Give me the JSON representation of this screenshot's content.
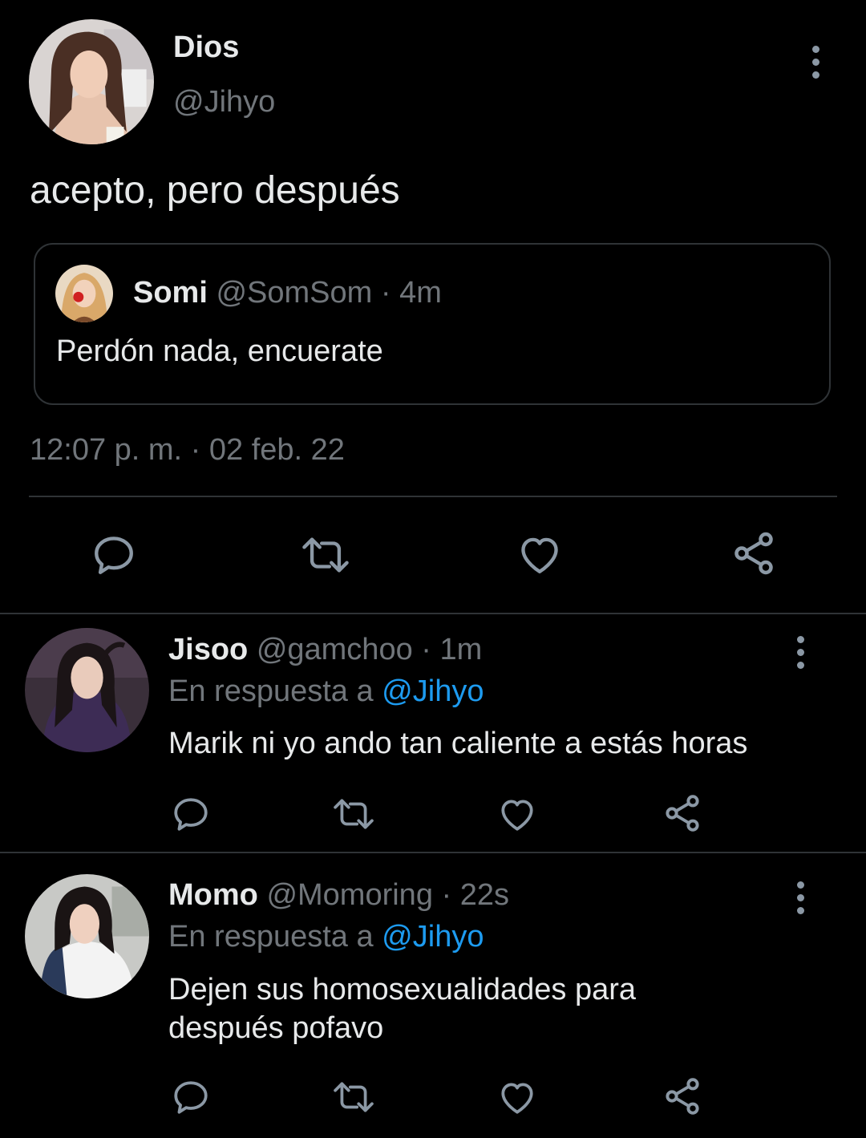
{
  "main_tweet": {
    "display_name": "Dios",
    "handle": "@Jihyo",
    "text": "acepto, pero después",
    "timestamp": "12:07 p. m. · 02 feb. 22",
    "quoted": {
      "display_name": "Somi",
      "handle": "@SomSom",
      "separator": "·",
      "time": "4m",
      "text": "Perdón nada, encuerate"
    }
  },
  "replies": [
    {
      "display_name": "Jisoo",
      "handle": "@gamchoo",
      "separator": "·",
      "time": "1m",
      "in_reply_prefix": "En respuesta a",
      "in_reply_mention": "@Jihyo",
      "text": "Marik ni yo ando tan caliente a estás horas"
    },
    {
      "display_name": "Momo",
      "handle": "@Momoring",
      "separator": "·",
      "time": "22s",
      "in_reply_prefix": "En respuesta a",
      "in_reply_mention": "@Jihyo",
      "text": "Dejen sus homosexualidades para después pofavo"
    }
  ],
  "icons": {
    "reply": "reply-icon",
    "retweet": "retweet-icon",
    "like": "heart-icon",
    "share": "share-icon",
    "more": "more-vertical-icon"
  },
  "colors": {
    "background": "#000000",
    "text_primary": "#e7e9ea",
    "text_secondary": "#71767b",
    "mention": "#1d9bf0",
    "icon": "#8b98a5",
    "divider": "#2f3336"
  }
}
